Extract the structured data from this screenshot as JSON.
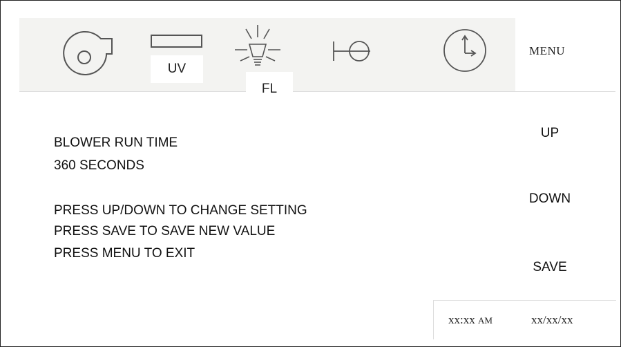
{
  "toolbar": {
    "icons": [
      {
        "name": "blower-fan-icon"
      },
      {
        "name": "uv-lamp-icon",
        "label": "UV"
      },
      {
        "name": "fluorescent-light-icon",
        "label": "FL"
      },
      {
        "name": "sash-valve-icon"
      },
      {
        "name": "clock-timer-icon"
      }
    ],
    "menu_label": "MENU"
  },
  "setting": {
    "title": "BLOWER RUN TIME",
    "value": "360 SECONDS"
  },
  "instructions": [
    "PRESS UP/DOWN TO CHANGE SETTING",
    "PRESS SAVE TO SAVE NEW VALUE",
    "PRESS MENU TO EXIT"
  ],
  "side_buttons": {
    "up": "UP",
    "down": "DOWN",
    "save": "SAVE"
  },
  "status": {
    "time": "xx:xx",
    "ampm": "AM",
    "date": "xx/xx/xx"
  }
}
